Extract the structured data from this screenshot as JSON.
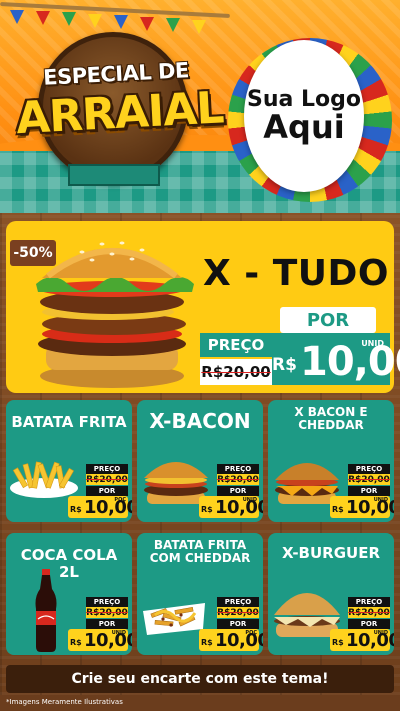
{
  "header": {
    "badge_line1": "ESPECIAL DE",
    "badge_line2": "ARRAIAL",
    "logo_line1": "Sua Logo",
    "logo_line2": "Aqui"
  },
  "featured": {
    "discount": "-50%",
    "name": "X - TUDO",
    "label_por": "POR",
    "label_preco": "PREÇO",
    "old_price": "R$20,00",
    "currency": "R$",
    "new_price": "10,00",
    "unit": "UNID"
  },
  "cards": [
    {
      "name": "BATATA FRITA",
      "preco": "PREÇO",
      "old": "R$20,00",
      "por": "POR",
      "currency": "R$",
      "price": "10,00",
      "unit": "POÇ"
    },
    {
      "name": "X-BACON",
      "preco": "PREÇO",
      "old": "R$20,00",
      "por": "POR",
      "currency": "R$",
      "price": "10,00",
      "unit": "UNID"
    },
    {
      "name": "X BACON E CHEDDAR",
      "preco": "PREÇO",
      "old": "R$20,00",
      "por": "POR",
      "currency": "R$",
      "price": "10,00",
      "unit": "UNID"
    },
    {
      "name": "COCA COLA 2L",
      "preco": "PREÇO",
      "old": "R$20,00",
      "por": "POR",
      "currency": "R$",
      "price": "10,00",
      "unit": "UNID"
    },
    {
      "name": "BATATA FRITA COM CHEDDAR",
      "preco": "PREÇO",
      "old": "R$20,00",
      "por": "POR",
      "currency": "R$",
      "price": "10,00",
      "unit": "POÇ"
    },
    {
      "name": "X-BURGUER",
      "preco": "PREÇO",
      "old": "R$20,00",
      "por": "POR",
      "currency": "R$",
      "price": "10,00",
      "unit": "UNID"
    }
  ],
  "footer": {
    "cta": "Crie seu encarte com este tema!",
    "disclaimer": "*Imagens Meramente Ilustrativas"
  },
  "colors": {
    "orange": "#ff8f12",
    "teal": "#1d9a85",
    "yellow": "#ffcb13",
    "wood": "#6e3f1c"
  }
}
